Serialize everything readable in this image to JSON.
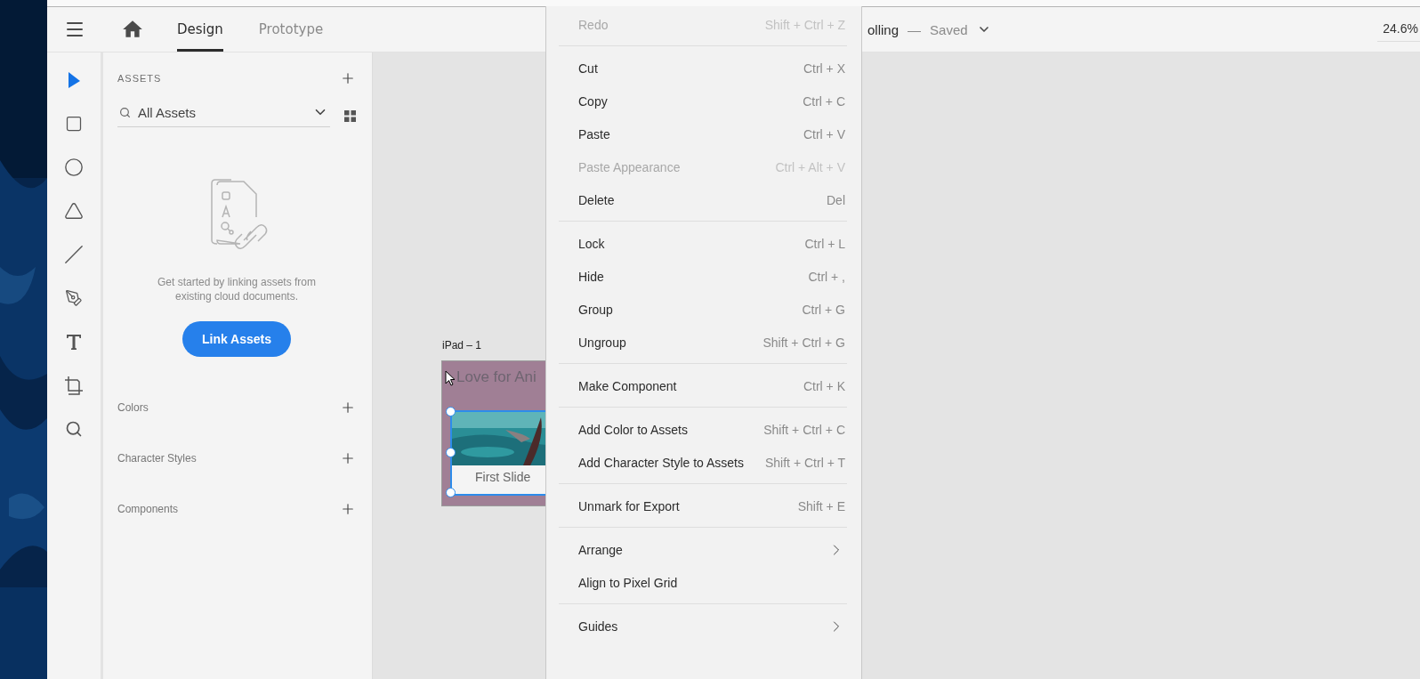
{
  "topbar": {
    "tabs": [
      {
        "label": "Design",
        "selected": true
      },
      {
        "label": "Prototype",
        "selected": false
      }
    ],
    "document_title": "olling",
    "separator": "—",
    "save_status": "Saved",
    "zoom": "24.6%"
  },
  "tools": [
    {
      "kind": "select",
      "selected": true
    },
    {
      "kind": "rectangle",
      "selected": false
    },
    {
      "kind": "ellipse",
      "selected": false
    },
    {
      "kind": "polygon",
      "selected": false
    },
    {
      "kind": "line",
      "selected": false
    },
    {
      "kind": "pen",
      "selected": false
    },
    {
      "kind": "text",
      "selected": false
    },
    {
      "kind": "artboard",
      "selected": false
    },
    {
      "kind": "zoom",
      "selected": false
    }
  ],
  "assets": {
    "heading": "ASSETS",
    "filter": "All Assets",
    "empty_message": "Get started by linking assets from existing cloud documents.",
    "button": "Link Assets",
    "sections": [
      "Colors",
      "Character Styles",
      "Components"
    ]
  },
  "canvas": {
    "artboard_label": "iPad – 1",
    "artboard_heading": "Love for Ani",
    "slide_caption": "First Slide"
  },
  "context_menu": {
    "groups": [
      [
        {
          "label": "Redo",
          "shortcut": "Shift + Ctrl + Z",
          "disabled": true,
          "submenu": false
        }
      ],
      [
        {
          "label": "Cut",
          "shortcut": "Ctrl + X",
          "disabled": false,
          "submenu": false
        },
        {
          "label": "Copy",
          "shortcut": "Ctrl + C",
          "disabled": false,
          "submenu": false
        },
        {
          "label": "Paste",
          "shortcut": "Ctrl + V",
          "disabled": false,
          "submenu": false
        },
        {
          "label": "Paste Appearance",
          "shortcut": "Ctrl + Alt + V",
          "disabled": true,
          "submenu": false
        },
        {
          "label": "Delete",
          "shortcut": "Del",
          "disabled": false,
          "submenu": false
        }
      ],
      [
        {
          "label": "Lock",
          "shortcut": "Ctrl + L",
          "disabled": false,
          "submenu": false
        },
        {
          "label": "Hide",
          "shortcut": "Ctrl + ,",
          "disabled": false,
          "submenu": false
        },
        {
          "label": "Group",
          "shortcut": "Ctrl + G",
          "disabled": false,
          "submenu": false
        },
        {
          "label": "Ungroup",
          "shortcut": "Shift + Ctrl + G",
          "disabled": false,
          "submenu": false
        }
      ],
      [
        {
          "label": "Make Component",
          "shortcut": "Ctrl + K",
          "disabled": false,
          "submenu": false
        }
      ],
      [
        {
          "label": "Add Color to Assets",
          "shortcut": "Shift + Ctrl + C",
          "disabled": false,
          "submenu": false
        },
        {
          "label": "Add Character Style to Assets",
          "shortcut": "Shift + Ctrl + T",
          "disabled": false,
          "submenu": false
        }
      ],
      [
        {
          "label": "Unmark for Export",
          "shortcut": "Shift + E",
          "disabled": false,
          "submenu": false
        }
      ],
      [
        {
          "label": "Arrange",
          "disabled": false,
          "submenu": true
        },
        {
          "label": "Align to Pixel Grid",
          "disabled": false,
          "submenu": false
        }
      ],
      [
        {
          "label": "Guides",
          "disabled": false,
          "submenu": true
        }
      ]
    ]
  }
}
